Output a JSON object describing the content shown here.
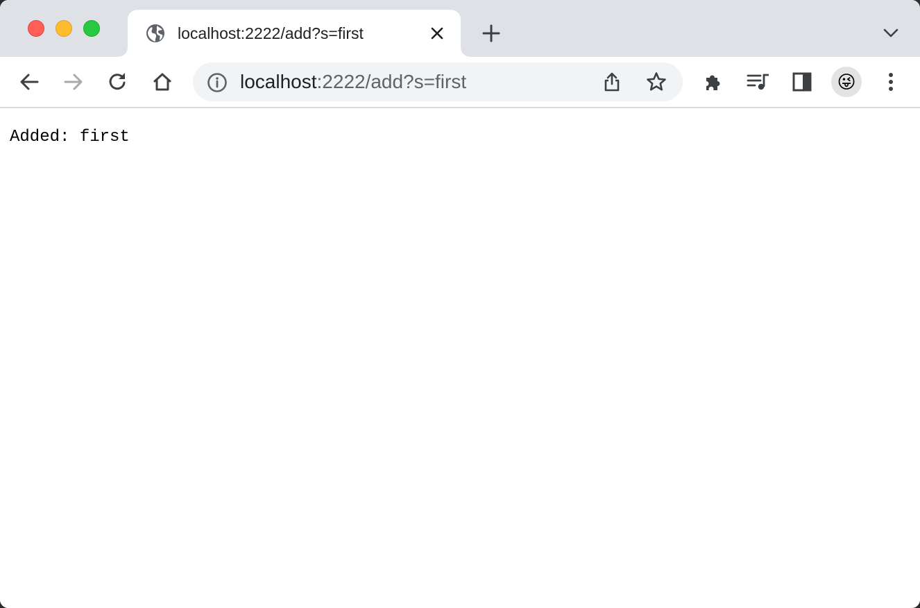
{
  "window": {
    "controls": [
      "close",
      "minimize",
      "maximize"
    ],
    "colors": {
      "close": "#ff5f57",
      "minimize": "#febc2e",
      "maximize": "#28c840"
    }
  },
  "tab": {
    "title": "localhost:2222/add?s=first",
    "favicon": "globe-icon",
    "close_icon": "close-icon"
  },
  "tabstrip": {
    "new_tab_icon": "plus-icon",
    "tab_search_icon": "chevron-down-icon"
  },
  "toolbar": {
    "back_icon": "arrow-left-icon",
    "forward_icon": "arrow-right-icon",
    "reload_icon": "reload-icon",
    "home_icon": "home-icon",
    "extensions_icon": "puzzle-icon",
    "media_icon": "media-queue-icon",
    "side_panel_icon": "side-panel-icon",
    "menu_icon": "kebab-menu-icon"
  },
  "omnibox": {
    "info_icon": "info-icon",
    "host": "localhost",
    "rest": ":2222/add?s=first",
    "share_icon": "share-icon",
    "bookmark_icon": "star-icon"
  },
  "profile": {
    "avatar": "😜"
  },
  "page": {
    "text": "Added: first"
  }
}
